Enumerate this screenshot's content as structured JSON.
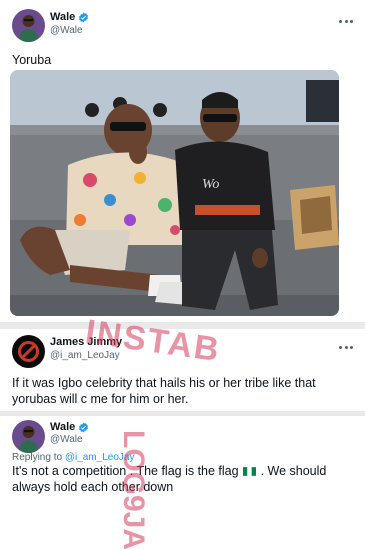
{
  "tweet1": {
    "name": "Wale",
    "handle": "@Wale",
    "text": "Yoruba"
  },
  "tweet2": {
    "name": "James Jimmy",
    "handle": "@i_am_LeoJay",
    "text": "If it was Igbo celebrity that hails his or her tribe like that yorubas will c me for him or her."
  },
  "tweet3": {
    "name": "Wale",
    "handle": "@Wale",
    "replying_prefix": "Replying to",
    "replying_handle": "@i_am_LeoJay",
    "text_part1": "It's not a competition . The flag is the flag",
    "text_part2": ". We should always hold each other down"
  },
  "watermark": {
    "top": "INSTAB",
    "side": "LOG9JA"
  },
  "colors": {
    "verified": "#1d9bf0",
    "link": "#1d9bf0",
    "watermark": "#d63c5f",
    "flag_green": "#008751"
  },
  "icons": [
    "verified-badge-icon",
    "more-options-icon",
    "nigeria-flag-icon"
  ]
}
